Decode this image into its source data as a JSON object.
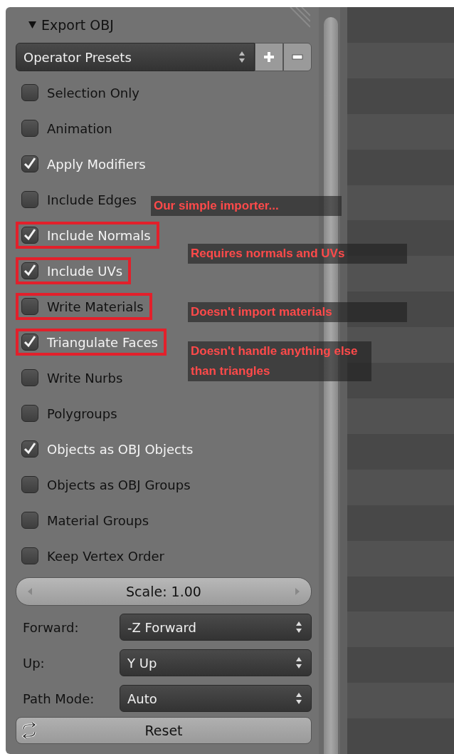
{
  "panel": {
    "title": "Export OBJ",
    "expanded": true
  },
  "presets": {
    "value": "Operator Presets"
  },
  "checkboxes": [
    {
      "label": "Selection Only",
      "checked": false,
      "highlighted": false
    },
    {
      "label": "Animation",
      "checked": false,
      "highlighted": false
    },
    {
      "label": "Apply Modifiers",
      "checked": true,
      "highlighted": false
    },
    {
      "label": "Include Edges",
      "checked": false,
      "highlighted": false
    },
    {
      "label": "Include Normals",
      "checked": true,
      "highlighted": true
    },
    {
      "label": "Include UVs",
      "checked": true,
      "highlighted": true
    },
    {
      "label": "Write Materials",
      "checked": false,
      "highlighted": true
    },
    {
      "label": "Triangulate Faces",
      "checked": true,
      "highlighted": true
    },
    {
      "label": "Write Nurbs",
      "checked": false,
      "highlighted": false
    },
    {
      "label": "Polygroups",
      "checked": false,
      "highlighted": false
    },
    {
      "label": "Objects as OBJ Objects",
      "checked": true,
      "highlighted": false
    },
    {
      "label": "Objects as OBJ Groups",
      "checked": false,
      "highlighted": false
    },
    {
      "label": "Material Groups",
      "checked": false,
      "highlighted": false
    },
    {
      "label": "Keep Vertex Order",
      "checked": false,
      "highlighted": false
    }
  ],
  "scale": {
    "text": "Scale: 1.00"
  },
  "dropdowns": [
    {
      "label": "Forward:",
      "value": "-Z Forward"
    },
    {
      "label": "Up:",
      "value": "Y Up"
    },
    {
      "label": "Path Mode:",
      "value": "Auto"
    }
  ],
  "reset_button": "Reset",
  "annotations": [
    {
      "text": "Our simple importer..."
    },
    {
      "text": "Requires normals and UVs"
    },
    {
      "text": "Doesn't import materials"
    },
    {
      "text": "Doesn't handle anything else than triangles"
    }
  ]
}
